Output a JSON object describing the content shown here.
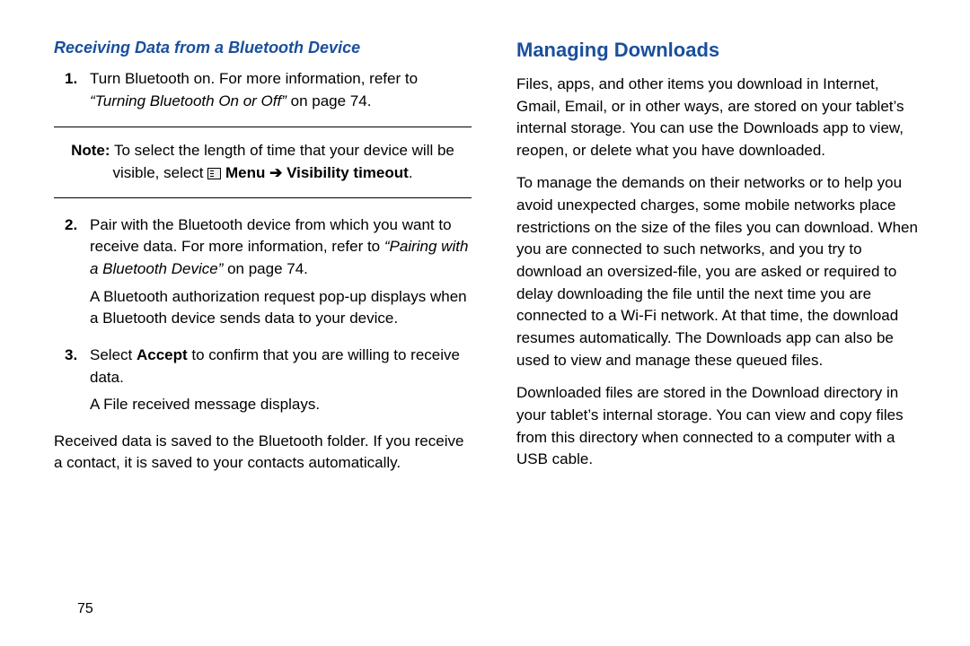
{
  "page_number": "75",
  "left": {
    "heading": "Receiving Data from a Bluetooth Device",
    "step1_a": "Turn Bluetooth on. For more information, refer to ",
    "step1_ref": "“Turning Bluetooth On or Off”",
    "step1_b": " on page 74.",
    "note_a": "Note:",
    "note_b": " To select the length of time that your device will be visible, select ",
    "note_menu": "Menu",
    "note_arrow": " ➔ ",
    "note_vis": "Visibility timeout",
    "note_end": ".",
    "step2_a": "Pair with the Bluetooth device from which you want to receive data. For more information, refer to ",
    "step2_ref": "“Pairing with a Bluetooth Device”",
    "step2_b": " on page 74.",
    "step2_c": "A Bluetooth authorization request pop-up displays when a Bluetooth device sends data to your device.",
    "step3_a": "Select ",
    "step3_accept": "Accept",
    "step3_b": " to confirm that you are willing to receive data.",
    "step3_c": "A File received message displays.",
    "closing": "Received data is saved to the Bluetooth folder. If you receive a contact, it is saved to your contacts automatically."
  },
  "right": {
    "heading": "Managing Downloads",
    "p1": "Files, apps, and other items you download in Internet, Gmail, Email, or in other ways, are stored on your tablet’s internal storage. You can use the Downloads app to view, reopen, or delete what you have downloaded.",
    "p2": "To manage the demands on their networks or to help you avoid unexpected charges, some mobile networks place restrictions on the size of the files you can download. When you are connected to such networks, and you try to download an oversized-file, you are asked or required to delay downloading the file until the next time you are connected to a Wi-Fi network. At that time, the download resumes automatically. The Downloads app can also be used to view and manage these queued files.",
    "p3": "Downloaded files are stored in the Download directory in your tablet’s internal storage. You can view and copy files from this directory when connected to a computer with a USB cable."
  }
}
